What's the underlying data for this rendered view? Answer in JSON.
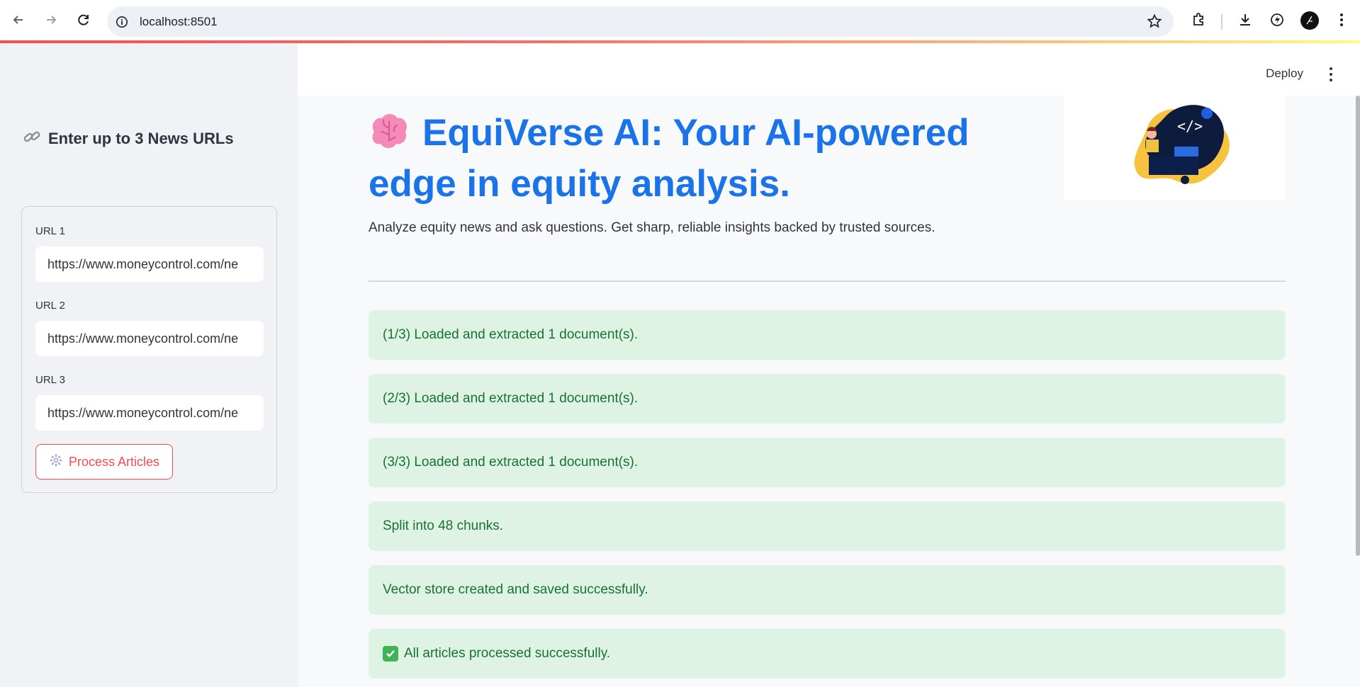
{
  "browser": {
    "url": "localhost:8501"
  },
  "header": {
    "deploy_label": "Deploy"
  },
  "sidebar": {
    "title": "Enter up to 3 News URLs",
    "fields": [
      {
        "label": "URL 1",
        "value": "https://www.moneycontrol.com/ne"
      },
      {
        "label": "URL 2",
        "value": "https://www.moneycontrol.com/ne"
      },
      {
        "label": "URL 3",
        "value": "https://www.moneycontrol.com/ne"
      }
    ],
    "process_button": "Process Articles"
  },
  "main": {
    "title": "EquiVerse AI: Your AI-powered edge in equity analysis.",
    "subtitle": "Analyze equity news and ask questions. Get sharp, reliable insights backed by trusted sources.",
    "messages": [
      "(1/3) Loaded and extracted 1 document(s).",
      "(2/3) Loaded and extracted 1 document(s).",
      "(3/3) Loaded and extracted 1 document(s).",
      "Split into 48 chunks.",
      "Vector store created and saved successfully.",
      "All articles processed successfully."
    ]
  },
  "colors": {
    "accent": "#ff4b4b",
    "title": "#1a73e8",
    "success_bg": "#dff3e5",
    "success_text": "#177233"
  }
}
